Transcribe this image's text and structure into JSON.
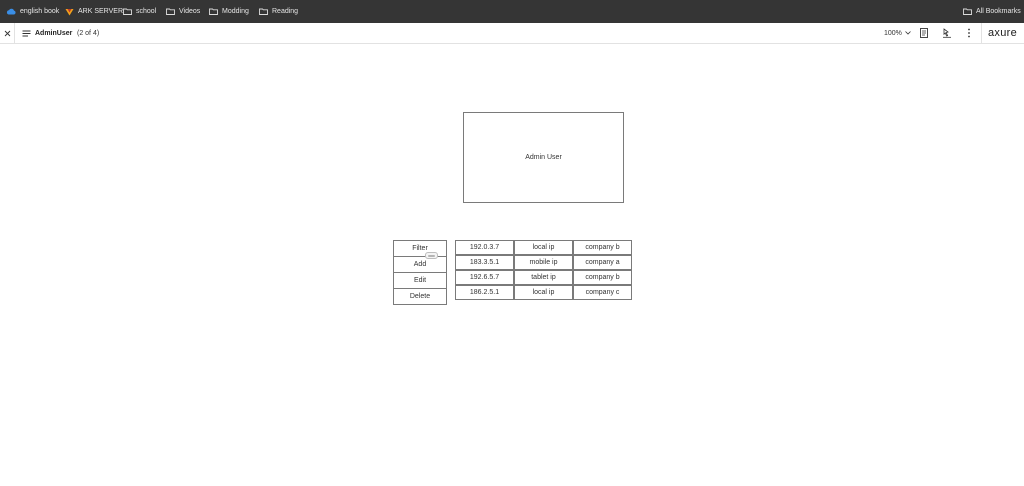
{
  "bookmarks": {
    "items": [
      {
        "label": "english book",
        "icon": "cloud-icon"
      },
      {
        "label": "ARK SERVER",
        "icon": "ark-icon"
      },
      {
        "label": "school",
        "icon": "folder-icon"
      },
      {
        "label": "Videos",
        "icon": "folder-icon"
      },
      {
        "label": "Modding",
        "icon": "folder-icon"
      },
      {
        "label": "Reading",
        "icon": "folder-icon"
      }
    ],
    "all_bookmarks": "All Bookmarks"
  },
  "toolbar": {
    "page_name": "AdminUser",
    "page_count": "(2 of 4)",
    "zoom": "100%",
    "brand": "axure"
  },
  "canvas": {
    "header_box": "Admin User",
    "actions": [
      "Filter",
      "Add",
      "Edit",
      "Delete"
    ],
    "table": [
      [
        "192.0.3.7",
        "local ip",
        "company b"
      ],
      [
        "183.3.5.1",
        "mobile ip",
        "company a"
      ],
      [
        "192.6.5.7",
        "tablet ip",
        "company b"
      ],
      [
        "186.2.5.1",
        "local ip",
        "company c"
      ]
    ]
  },
  "colors": {
    "bookmarks_bar": "#353535",
    "cloud_icon": "#3a8ee6",
    "ark_icon": "#f2a31b",
    "widget_border": "#7a7a7a"
  }
}
